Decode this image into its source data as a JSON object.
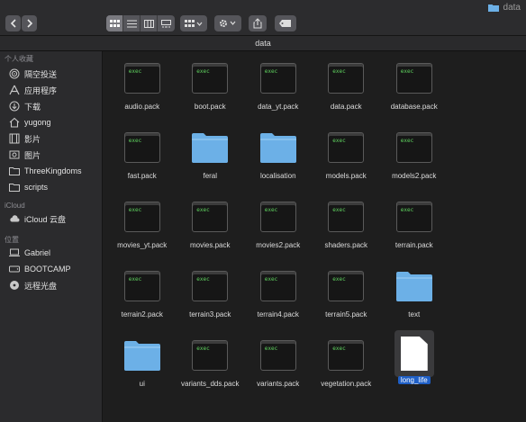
{
  "window": {
    "title": "data"
  },
  "path_title": "data",
  "sidebar": {
    "favorites_title": "个人收藏",
    "favorites": [
      {
        "label": "隔空投送",
        "icon": "airdrop-icon"
      },
      {
        "label": "应用程序",
        "icon": "applications-icon"
      },
      {
        "label": "下载",
        "icon": "downloads-icon"
      },
      {
        "label": "yugong",
        "icon": "home-icon"
      },
      {
        "label": "影片",
        "icon": "movies-icon"
      },
      {
        "label": "图片",
        "icon": "pictures-icon"
      },
      {
        "label": "ThreeKingdoms",
        "icon": "folder-icon"
      },
      {
        "label": "scripts",
        "icon": "folder-icon"
      }
    ],
    "icloud_title": "iCloud",
    "icloud": [
      {
        "label": "iCloud 云盘",
        "icon": "cloud-icon"
      }
    ],
    "locations_title": "位置",
    "locations": [
      {
        "label": "Gabriel",
        "icon": "computer-icon"
      },
      {
        "label": "BOOTCAMP",
        "icon": "drive-icon"
      },
      {
        "label": "远程光盘",
        "icon": "disc-icon"
      }
    ]
  },
  "exec_label": "exec",
  "files": [
    {
      "name": "audio.pack",
      "kind": "exec"
    },
    {
      "name": "boot.pack",
      "kind": "exec"
    },
    {
      "name": "data_yt.pack",
      "kind": "exec"
    },
    {
      "name": "data.pack",
      "kind": "exec"
    },
    {
      "name": "database.pack",
      "kind": "exec"
    },
    {
      "name": "fast.pack",
      "kind": "exec"
    },
    {
      "name": "feral",
      "kind": "folder"
    },
    {
      "name": "localisation",
      "kind": "folder"
    },
    {
      "name": "models.pack",
      "kind": "exec"
    },
    {
      "name": "models2.pack",
      "kind": "exec"
    },
    {
      "name": "movies_yt.pack",
      "kind": "exec"
    },
    {
      "name": "movies.pack",
      "kind": "exec"
    },
    {
      "name": "movies2.pack",
      "kind": "exec"
    },
    {
      "name": "shaders.pack",
      "kind": "exec"
    },
    {
      "name": "terrain.pack",
      "kind": "exec"
    },
    {
      "name": "terrain2.pack",
      "kind": "exec"
    },
    {
      "name": "terrain3.pack",
      "kind": "exec"
    },
    {
      "name": "terrain4.pack",
      "kind": "exec"
    },
    {
      "name": "terrain5.pack",
      "kind": "exec"
    },
    {
      "name": "text",
      "kind": "folder"
    },
    {
      "name": "ui",
      "kind": "folder"
    },
    {
      "name": "variants_dds.pack",
      "kind": "exec"
    },
    {
      "name": "variants.pack",
      "kind": "exec"
    },
    {
      "name": "vegetation.pack",
      "kind": "exec"
    },
    {
      "name": "long_life",
      "kind": "document",
      "selected": true
    }
  ],
  "colors": {
    "folder": "#6cb0e6",
    "exec_text": "#5fd35f",
    "selection": "#1f5fc6"
  }
}
